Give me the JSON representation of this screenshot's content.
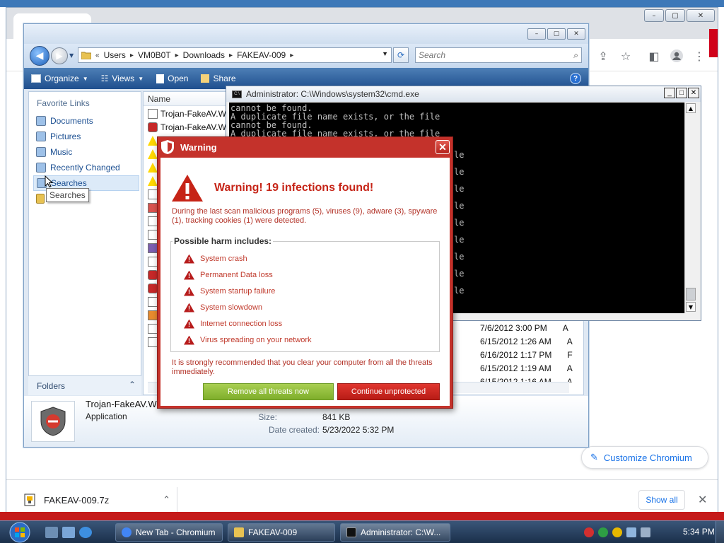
{
  "chrome": {
    "tab_title": "New Tab - Chromium",
    "customize_label": "Customize Chromium",
    "download": {
      "file_name": "FAKEAV-009.7z",
      "show_all_label": "Show all"
    }
  },
  "explorer": {
    "breadcrumb": [
      "Users",
      "VM0B0T",
      "Downloads",
      "FAKEAV-009"
    ],
    "search_placeholder": "Search",
    "toolbar": {
      "organize": "Organize",
      "views": "Views",
      "open": "Open",
      "share": "Share"
    },
    "favorite_links_title": "Favorite Links",
    "favorites": [
      "Documents",
      "Pictures",
      "Music",
      "Recently Changed",
      "Searches"
    ],
    "tooltip": "Searches",
    "folders_label": "Folders",
    "column_name": "Name",
    "files": [
      "Trojan-FakeAV.W",
      "Trojan-FakeAV.W"
    ],
    "dates": [
      {
        "date": "7/6/2012 3:00 PM",
        "type": "A"
      },
      {
        "date": "6/15/2012 1:26 AM",
        "type": "A"
      },
      {
        "date": "6/16/2012 1:17 PM",
        "type": "F"
      },
      {
        "date": "6/15/2012 1:19 AM",
        "type": "A"
      },
      {
        "date": "6/15/2012 1:16 AM",
        "type": "A"
      }
    ],
    "details": {
      "name": "Trojan-FakeAV.W",
      "type": "Application",
      "size_label": "Size:",
      "size_value": "841 KB",
      "created_label": "Date created:",
      "created_value": "5/23/2022 5:32 PM"
    }
  },
  "cmd": {
    "title": "Administrator: C:\\Windows\\system32\\cmd.exe",
    "lines": [
      "cannot be found.",
      "A duplicate file name exists, or the file",
      "cannot be found.",
      "A duplicate file name exists, or the file"
    ],
    "right_fragment": "le"
  },
  "warning": {
    "title": "Warning",
    "heading": "Warning! 19 infections found!",
    "description": "During the last scan malicious programs (5), viruses (9), adware (3), spyware (1), tracking cookies (1) were detected.",
    "harm_title": "Possible harm includes:",
    "harms": [
      "System crash",
      "Permanent Data loss",
      "System startup failure",
      "System slowdown",
      "Internet connection loss",
      "Virus spreading on your network"
    ],
    "recommendation": "It is strongly recommended that you clear your computer from all the threats immediately.",
    "remove_label": "Remove all threats now",
    "continue_label": "Continue unprotected"
  },
  "taskbar": {
    "buttons": [
      "New Tab - Chromium",
      "FAKEAV-009",
      "Administrator: C:\\W..."
    ],
    "clock": "5:34 PM"
  },
  "colors": {
    "warning_red": "#c4322b",
    "remove_green": "#8cbd37",
    "chrome_link": "#1a73e8"
  }
}
